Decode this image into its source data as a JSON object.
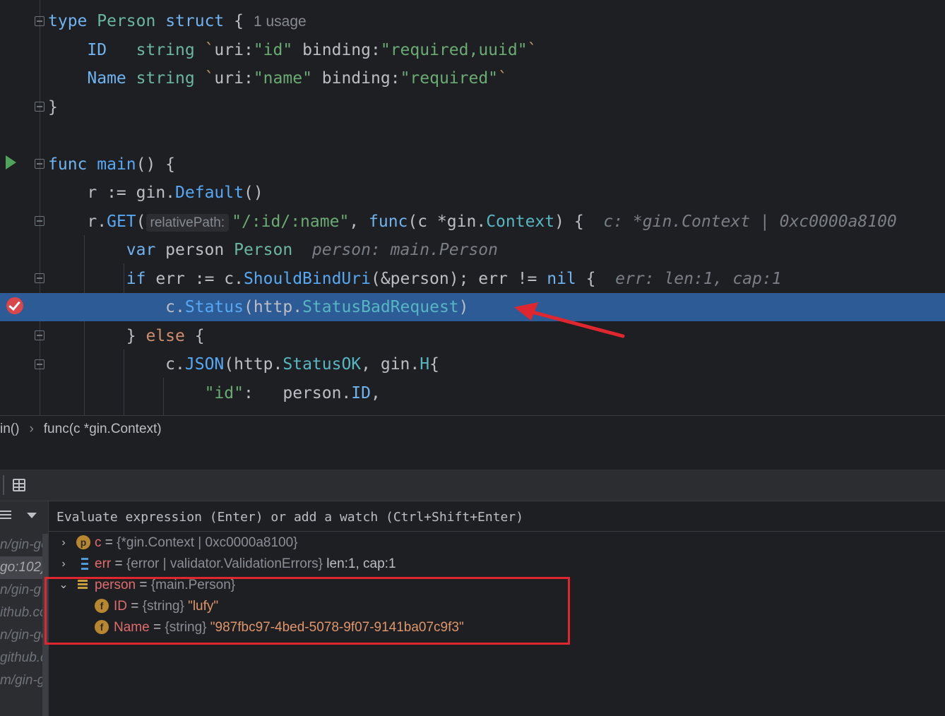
{
  "editor": {
    "lines": [
      {
        "id": "l1",
        "segments": [
          {
            "t": "type ",
            "c": "kw2"
          },
          {
            "t": "Person ",
            "c": "ty"
          },
          {
            "t": "struct",
            "c": "kw2"
          },
          {
            "t": " {",
            "c": ""
          }
        ],
        "usage": "1 usage"
      },
      {
        "id": "l2",
        "segments": [
          {
            "t": "    ID   ",
            "c": "fld2"
          },
          {
            "t": "string",
            "c": "ty"
          },
          {
            "t": " `",
            "c": "tag"
          },
          {
            "t": "uri",
            "c": ""
          },
          {
            "t": ":",
            "c": ""
          },
          {
            "t": "\"id\"",
            "c": "str"
          },
          {
            "t": " binding",
            "c": ""
          },
          {
            "t": ":",
            "c": ""
          },
          {
            "t": "\"required,uuid\"",
            "c": "str"
          },
          {
            "t": "`",
            "c": "tag"
          }
        ]
      },
      {
        "id": "l3",
        "segments": [
          {
            "t": "    Name ",
            "c": "fld2"
          },
          {
            "t": "string",
            "c": "ty"
          },
          {
            "t": " `",
            "c": "tag"
          },
          {
            "t": "uri",
            "c": ""
          },
          {
            "t": ":",
            "c": ""
          },
          {
            "t": "\"name\"",
            "c": "str"
          },
          {
            "t": " binding",
            "c": ""
          },
          {
            "t": ":",
            "c": ""
          },
          {
            "t": "\"required\"",
            "c": "str"
          },
          {
            "t": "`",
            "c": "tag"
          }
        ]
      },
      {
        "id": "l4",
        "segments": [
          {
            "t": "}",
            "c": ""
          }
        ]
      },
      {
        "id": "l5",
        "segments": []
      },
      {
        "id": "l6",
        "segments": [
          {
            "t": "func ",
            "c": "kw2"
          },
          {
            "t": "main",
            "c": "fn2"
          },
          {
            "t": "() {",
            "c": ""
          }
        ]
      },
      {
        "id": "l7",
        "segments": [
          {
            "t": "    r := ",
            "c": ""
          },
          {
            "t": "gin",
            "c": ""
          },
          {
            "t": ".",
            "c": ""
          },
          {
            "t": "Default",
            "c": "fn"
          },
          {
            "t": "()",
            "c": ""
          }
        ]
      },
      {
        "id": "l8",
        "segments": [
          {
            "t": "    r.",
            "c": ""
          },
          {
            "t": "GET",
            "c": "fn"
          },
          {
            "t": "(",
            "c": ""
          }
        ],
        "hint": "relativePath:",
        "after": [
          {
            "t": "\"/:id/:name\"",
            "c": "str"
          },
          {
            "t": ", ",
            "c": ""
          },
          {
            "t": "func",
            "c": "kw2"
          },
          {
            "t": "(c *",
            "c": ""
          },
          {
            "t": "gin",
            "c": ""
          },
          {
            "t": ".",
            "c": ""
          },
          {
            "t": "Context",
            "c": "tycall"
          },
          {
            "t": ") {",
            "c": ""
          }
        ],
        "inlay": "  c: *gin.Context | 0xc0000a8100"
      },
      {
        "id": "l9",
        "segments": [
          {
            "t": "        ",
            "c": ""
          },
          {
            "t": "var ",
            "c": "kw2"
          },
          {
            "t": "person ",
            "c": ""
          },
          {
            "t": "Person",
            "c": "ty"
          }
        ],
        "inlay": "  person: main.Person"
      },
      {
        "id": "l10",
        "segments": [
          {
            "t": "        ",
            "c": ""
          },
          {
            "t": "if ",
            "c": "kw2"
          },
          {
            "t": "err := c.",
            "c": ""
          },
          {
            "t": "ShouldBindUri",
            "c": "fn"
          },
          {
            "t": "(&person); err != ",
            "c": ""
          },
          {
            "t": "nil",
            "c": "kw2"
          },
          {
            "t": " {",
            "c": ""
          }
        ],
        "inlay": "  err: len:1, cap:1"
      },
      {
        "id": "l11",
        "segments": [
          {
            "t": "            c.",
            "c": ""
          },
          {
            "t": "Status",
            "c": "fn"
          },
          {
            "t": "(",
            "c": ""
          },
          {
            "t": "http",
            "c": ""
          },
          {
            "t": ".",
            "c": ""
          },
          {
            "t": "StatusBadRequest",
            "c": "tycall"
          },
          {
            "t": ")",
            "c": ""
          }
        ]
      },
      {
        "id": "l12",
        "segments": [
          {
            "t": "        } ",
            "c": ""
          },
          {
            "t": "else",
            "c": "kw"
          },
          {
            "t": " {",
            "c": ""
          }
        ]
      },
      {
        "id": "l13",
        "segments": [
          {
            "t": "            c.",
            "c": ""
          },
          {
            "t": "JSON",
            "c": "fn"
          },
          {
            "t": "(",
            "c": ""
          },
          {
            "t": "http",
            "c": ""
          },
          {
            "t": ".",
            "c": ""
          },
          {
            "t": "StatusOK",
            "c": "tycall"
          },
          {
            "t": ", ",
            "c": ""
          },
          {
            "t": "gin",
            "c": ""
          },
          {
            "t": ".",
            "c": ""
          },
          {
            "t": "H",
            "c": "tycall"
          },
          {
            "t": "{",
            "c": ""
          }
        ]
      },
      {
        "id": "l14",
        "segments": [
          {
            "t": "                ",
            "c": ""
          },
          {
            "t": "\"id\"",
            "c": "str"
          },
          {
            "t": ":   person.",
            "c": ""
          },
          {
            "t": "ID",
            "c": "fld2"
          },
          {
            "t": ",",
            "c": ""
          }
        ]
      }
    ]
  },
  "breadcrumb": {
    "items": [
      "in()",
      "func(c *gin.Context)"
    ]
  },
  "debug": {
    "eval_placeholder": "Evaluate expression (Enter) or add a watch (Ctrl+Shift+Enter)",
    "frames": [
      "n/gin-go",
      "go:102)",
      "n/gin-g",
      "ithub.co",
      "n/gin-go",
      "github.c",
      "m/gin-g"
    ],
    "variables": [
      {
        "id": "v-c",
        "name": "c",
        "eq": " = ",
        "type": "{*gin.Context | 0xc0000a8100}",
        "value": "",
        "badge": "p",
        "expand": "›"
      },
      {
        "id": "v-err",
        "name": "err",
        "eq": " = ",
        "type": "{error | validator.ValidationErrors}",
        "value": " len:1, cap:1",
        "expand": "›"
      },
      {
        "id": "v-person",
        "name": "person",
        "eq": " = ",
        "type": "{main.Person}",
        "value": "",
        "expand": "⌄"
      },
      {
        "id": "v-id",
        "name": "ID",
        "eq": " = ",
        "type": "{string}",
        "value": " \"lufy\"",
        "badge": "f"
      },
      {
        "id": "v-name",
        "name": "Name",
        "eq": " = ",
        "type": "{string}",
        "value": " \"987fbc97-4bed-5078-9f07-9141ba07c9f3\"",
        "badge": "f"
      }
    ]
  },
  "colors": {
    "current_line": "#2d5b95",
    "annotation": "#e0262e",
    "breakpoint": "#d9464b"
  }
}
